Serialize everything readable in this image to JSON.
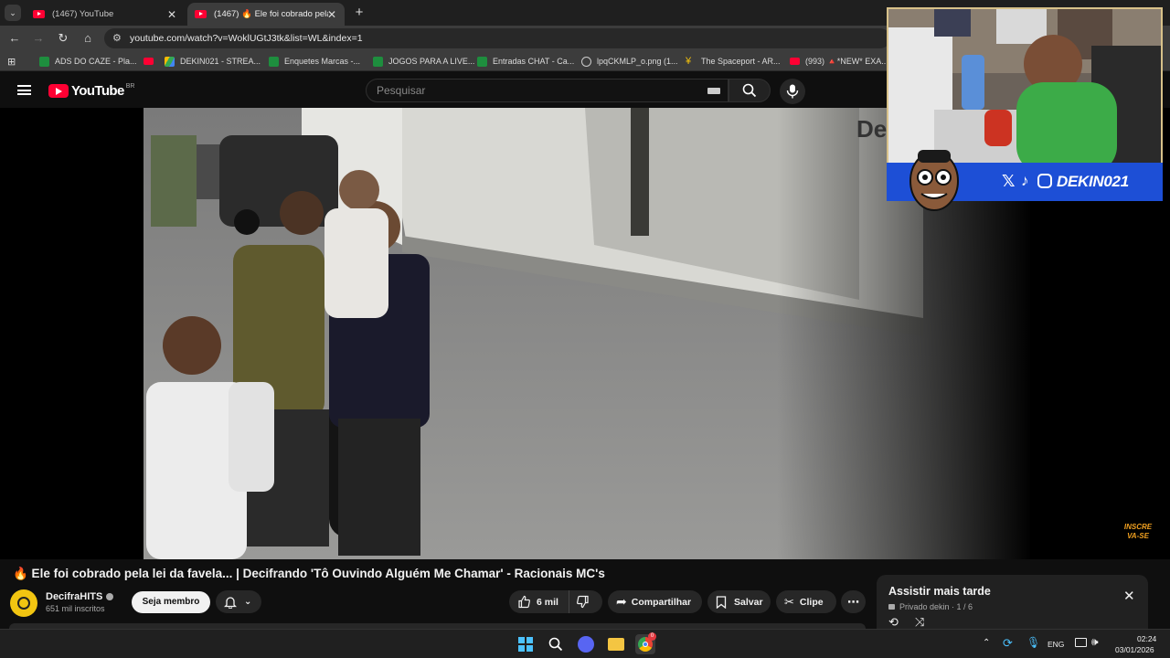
{
  "browser": {
    "tabs": [
      {
        "label": "(1467) YouTube",
        "active": false
      },
      {
        "label": "(1467) 🔥 Ele foi cobrado pela",
        "active": true
      }
    ],
    "url": "youtube.com/watch?v=WoklUGtJ3tk&list=WL&index=1",
    "bookmarks": [
      "ADS DO CAZE - Pla...",
      "DEKIN021 - STREA...",
      "Enquetes Marcas -...",
      "JOGOS PARA A LIVE...",
      "Entradas CHAT - Ca...",
      "lpqCKMLP_o.png (1...",
      "The Spaceport - AR...",
      "(993) 🔺*NEW* EXA..."
    ]
  },
  "youtube": {
    "logo_text": "YouTube",
    "region": "BR",
    "search_placeholder": "Pesquisar"
  },
  "video": {
    "watermark_text": "De",
    "subscribe_badge": "INSCRE VA-SE"
  },
  "webcam": {
    "handle": "DEKIN021"
  },
  "details": {
    "title": "🔥 Ele foi cobrado pela lei da favela... | Decifrando 'Tô Ouvindo Alguém Me Chamar' - Racionais MC's",
    "channel_name": "DecifraHITS",
    "subscribers": "651 mil inscritos",
    "join_label": "Seja membro",
    "likes": "6 mil",
    "share_label": "Compartilhar",
    "save_label": "Salvar",
    "clip_label": "Clipe"
  },
  "watch_later": {
    "title": "Assistir mais tarde",
    "meta": "Privado dekin · 1 / 6"
  },
  "taskbar": {
    "language": "ENG",
    "time": "02:24",
    "date": "03/01/2026",
    "chrome_badge": "0"
  },
  "colors": {
    "yt_red": "#ff0033",
    "accent_blue": "#1d4fd6",
    "bg": "#0f0f0f"
  }
}
